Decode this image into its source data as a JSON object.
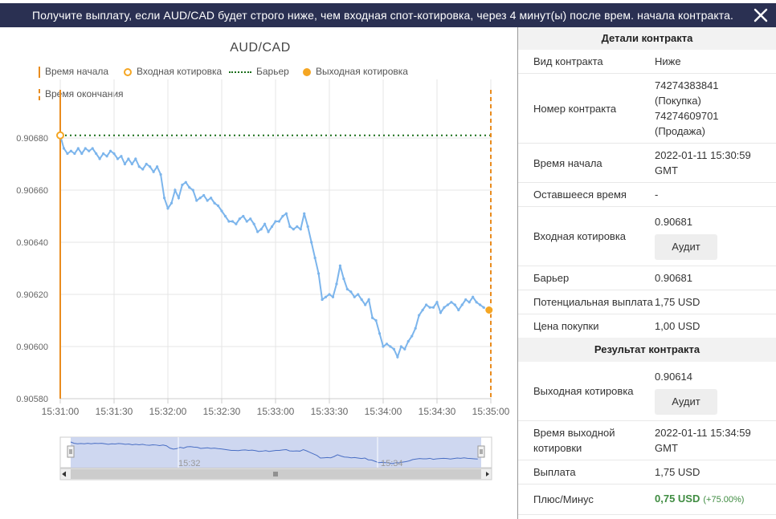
{
  "header": {
    "title": "Получите выплату, если AUD/CAD будет строго ниже, чем входная спот-котировка, через 4 минут(ы) после врем. начала контракта."
  },
  "chart_data": {
    "type": "line",
    "title": "AUD/CAD",
    "x_ticks": [
      "15:31:00",
      "15:31:30",
      "15:32:00",
      "15:32:30",
      "15:33:00",
      "15:33:30",
      "15:34:00",
      "15:34:30",
      "15:35:00"
    ],
    "y_ticks": [
      "0.90580",
      "0.90600",
      "0.90620",
      "0.90640",
      "0.90660",
      "0.90680"
    ],
    "ylim": [
      0.9058,
      0.90684
    ],
    "xlim_seconds": [
      0,
      240
    ],
    "barrier": 0.90681,
    "entry": {
      "t": 0,
      "value": 0.90681
    },
    "exit": {
      "t": 239,
      "value": 0.90614
    },
    "legend": {
      "start": "Время начала",
      "entry": "Входная котировка",
      "barrier": "Барьер",
      "exit": "Выходная котировка",
      "end": "Время окончания"
    },
    "navigator_labels": [
      "15:32",
      "15:34"
    ],
    "series": [
      {
        "t": [
          0,
          2,
          4,
          6,
          8,
          10,
          12,
          14,
          16,
          18,
          20,
          22,
          24,
          26,
          28,
          30,
          32,
          34,
          36,
          38,
          40,
          42,
          44,
          46,
          48,
          50,
          52,
          54,
          56,
          58,
          60,
          62,
          64,
          66,
          68,
          70,
          72,
          74,
          76,
          78,
          80,
          82,
          84,
          86,
          88,
          90,
          92,
          94,
          96,
          98,
          100,
          102,
          104,
          106,
          108,
          110,
          112,
          114,
          116,
          118,
          120,
          122,
          124,
          126,
          128,
          130,
          132,
          134,
          136,
          138,
          140,
          142,
          144,
          146,
          148,
          150,
          152,
          154,
          156,
          158,
          160,
          162,
          164,
          166,
          168,
          170,
          172,
          174,
          176,
          178,
          180,
          182,
          184,
          186,
          188,
          190,
          192,
          194,
          196,
          198,
          200,
          202,
          204,
          206,
          208,
          210,
          212,
          214,
          216,
          218,
          220,
          222,
          224,
          226,
          228,
          230,
          232,
          234,
          236,
          238
        ],
        "values": [
          0.90681,
          0.90676,
          0.90674,
          0.90675,
          0.90674,
          0.90676,
          0.90674,
          0.90676,
          0.90675,
          0.90676,
          0.90674,
          0.90672,
          0.90674,
          0.90673,
          0.90675,
          0.90674,
          0.90672,
          0.90673,
          0.9067,
          0.90672,
          0.9067,
          0.90672,
          0.90669,
          0.90668,
          0.9067,
          0.90669,
          0.90667,
          0.90669,
          0.90666,
          0.90657,
          0.90653,
          0.90655,
          0.9066,
          0.90657,
          0.90662,
          0.90663,
          0.90661,
          0.9066,
          0.90656,
          0.90657,
          0.90658,
          0.90656,
          0.90657,
          0.90655,
          0.90654,
          0.90652,
          0.9065,
          0.90648,
          0.90648,
          0.90647,
          0.90649,
          0.9065,
          0.90648,
          0.90649,
          0.90647,
          0.90644,
          0.90645,
          0.90647,
          0.90644,
          0.90646,
          0.90648,
          0.90648,
          0.9065,
          0.90651,
          0.90646,
          0.90645,
          0.90646,
          0.90645,
          0.90651,
          0.90646,
          0.9064,
          0.90634,
          0.90628,
          0.90618,
          0.90619,
          0.9062,
          0.90619,
          0.90624,
          0.90631,
          0.90626,
          0.90622,
          0.90621,
          0.90619,
          0.9062,
          0.90618,
          0.90616,
          0.90618,
          0.90611,
          0.9061,
          0.90605,
          0.906,
          0.90601,
          0.906,
          0.90599,
          0.90596,
          0.906,
          0.90599,
          0.90602,
          0.90604,
          0.90607,
          0.90612,
          0.90614,
          0.90616,
          0.90615,
          0.90615,
          0.90617,
          0.90613,
          0.90615,
          0.90616,
          0.90617,
          0.90616,
          0.90614,
          0.90616,
          0.90618,
          0.90617,
          0.90619,
          0.90617,
          0.90616,
          0.90615,
          0.90614
        ]
      }
    ]
  },
  "panel": {
    "details_title": "Детали контракта",
    "type_label": "Вид контракта",
    "type_value": "Ниже",
    "number_label": "Номер контракта",
    "number_line1": "74274383841",
    "number_line2": "(Покупка)",
    "number_line3": "74274609701",
    "number_line4": "(Продажа)",
    "start_label": "Время начала",
    "start_value": "2022-01-11 15:30:59 GMT",
    "remaining_label": "Оставшееся время",
    "remaining_value": "-",
    "entry_label": "Входная котировка",
    "entry_value": "0.90681",
    "audit_label": "Аудит",
    "barrier_label": "Барьер",
    "barrier_value": "0.90681",
    "payout_pot_label": "Потенциальная выплата",
    "payout_pot_value": "1,75 USD",
    "price_label": "Цена покупки",
    "price_value": "1,00 USD",
    "result_title": "Результат контракта",
    "exit_label": "Выходная котировка",
    "exit_value": "0.90614",
    "exit_time_label": "Время выходной котировки",
    "exit_time_value": "2022-01-11 15:34:59 GMT",
    "payout_label": "Выплата",
    "payout_value": "1,75 USD",
    "pnl_label": "Плюс/Минус",
    "pnl_value": "0,75 USD",
    "pnl_pct": "(+75.00%)"
  },
  "colors": {
    "header_bg": "#2a3052",
    "line": "#7cb5ec",
    "start_line": "#e98c1e",
    "barrier": "#1a6e1a",
    "exit": "#f5a623",
    "profit": "#3f8c41"
  }
}
